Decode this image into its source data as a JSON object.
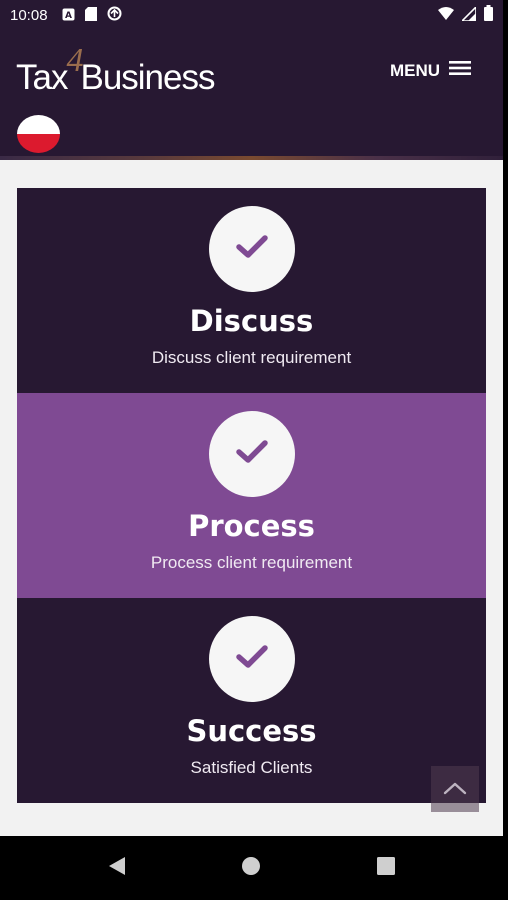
{
  "status_bar": {
    "time": "10:08",
    "left_icons": [
      "notification-a-icon",
      "sd-card-icon",
      "sync-icon"
    ],
    "right_icons": [
      "wifi-icon",
      "cellular-signal-icon",
      "battery-icon"
    ]
  },
  "header": {
    "logo_prefix": "Tax",
    "logo_number": "4",
    "logo_suffix": "Business",
    "menu_label": "MENU",
    "language_flag": "poland-flag-icon"
  },
  "colors": {
    "header_bg": "#271832",
    "card_dark": "#271832",
    "card_light": "#7f4a93",
    "check": "#7f4a93",
    "accent_logo": "#9a6d4d"
  },
  "steps": [
    {
      "title": "Discuss",
      "subtitle": "Discuss client requirement"
    },
    {
      "title": "Process",
      "subtitle": "Process client requirement"
    },
    {
      "title": "Success",
      "subtitle": "Satisfied Clients"
    }
  ],
  "nav_bar": {
    "buttons": [
      "back-icon",
      "home-icon",
      "recents-icon"
    ]
  }
}
